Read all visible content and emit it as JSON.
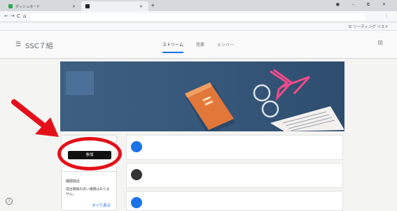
{
  "browser": {
    "tabs": [
      {
        "label": "ダッシュボード"
      },
      {
        "label": ""
      }
    ],
    "new_tab": "+",
    "window_controls": "● – ⧉ ✕",
    "nav_back": "←",
    "nav_forward": "→",
    "nav_reload": "C",
    "nav_home": "⌂",
    "address_value": "",
    "reading_list_label": "リーディング リスト"
  },
  "app": {
    "class_name": "SSC７組",
    "tabs": [
      "ストリーム",
      "授業",
      "メンバー"
    ],
    "active_tab": "ストリーム"
  },
  "upcoming": {
    "join_label": "参加"
  },
  "schedule": {
    "title": "期限間近",
    "text": "提出期限の近い課題はありません。",
    "view_all": "すべて表示"
  },
  "colors": {
    "accent": "#1a73e8",
    "highlight": "#e3101a",
    "banner": "#3d5f82"
  }
}
